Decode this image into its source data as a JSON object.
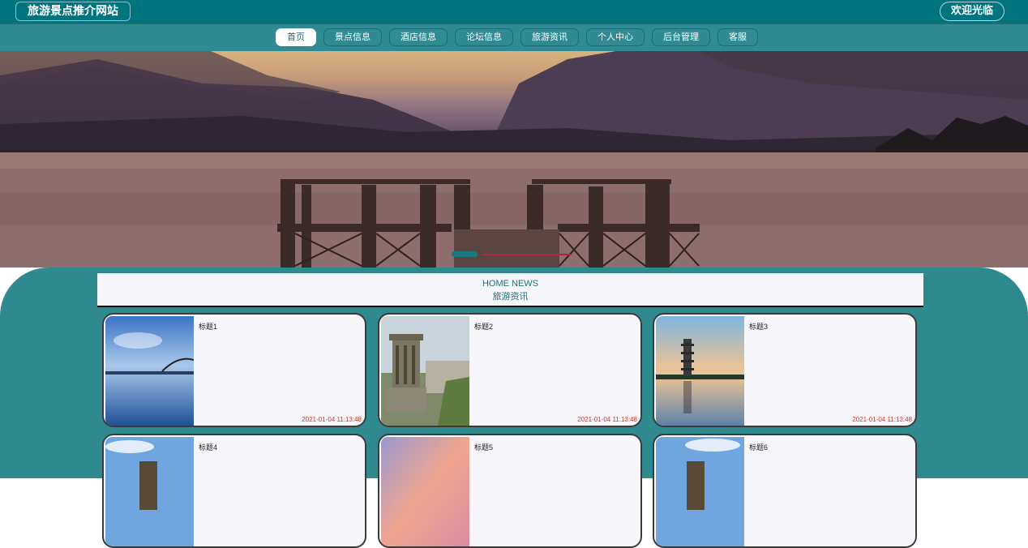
{
  "header": {
    "site_title": "旅游景点推介网站",
    "welcome": "欢迎光临"
  },
  "nav": {
    "items": [
      "首页",
      "景点信息",
      "酒店信息",
      "论坛信息",
      "旅游资讯",
      "个人中心",
      "后台管理",
      "客服"
    ],
    "active_index": 0
  },
  "news": {
    "title_en": "HOME NEWS",
    "title_cn": "旅游资讯",
    "items": [
      {
        "title": "标题1",
        "time": "2021-01-04 11:13:48"
      },
      {
        "title": "标题2",
        "time": "2021-01-04 11:13:48"
      },
      {
        "title": "标题3",
        "time": "2021-01-04 11:13:48"
      },
      {
        "title": "标题4",
        "time": ""
      },
      {
        "title": "标题5",
        "time": ""
      },
      {
        "title": "标题6",
        "time": ""
      }
    ]
  },
  "colors": {
    "primary": "#007580",
    "nav_bg": "#2f8a93",
    "content_bg": "#2f8a8f",
    "time_text": "#c0392b"
  }
}
